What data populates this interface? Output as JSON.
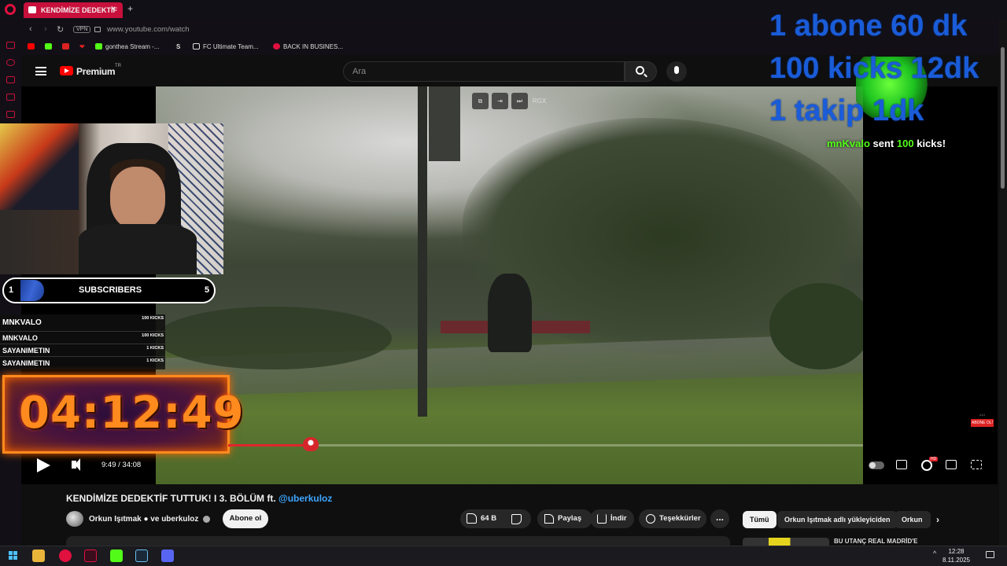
{
  "browser": {
    "tab_title": "KENDİMİZE DEDEKTİF",
    "tab_close": "×",
    "new_tab": "+",
    "vpn": "VPN",
    "url": "www.youtube.com/watch",
    "bookmarks": [
      {
        "label": "gonthea Stream -...",
        "color": "#53fc18"
      },
      {
        "label": "FC Ultimate Team...",
        "color": "#ffffff"
      },
      {
        "label": "BACK IN BUSINES...",
        "color": "#e0103f"
      }
    ],
    "bookmark_s": "S"
  },
  "youtube": {
    "brand": "Premium",
    "region": "TR",
    "search_placeholder": "Ara"
  },
  "video_overlays": {
    "pip_label": "RGX",
    "goals": [
      "1 abone 60 dk",
      "100 kicks 12dk",
      "1 takip 1dk"
    ],
    "kick_alert": {
      "user": "mnKvalo",
      "text_sent": "sent",
      "amount": "100",
      "text_kicks": "kicks!"
    },
    "subs_bar": {
      "start": "1",
      "label": "SUBSCRIBERS",
      "goal": "5",
      "progress_fraction": 0.2
    },
    "leaderboard": {
      "top": {
        "name": "MNKVALO",
        "value": "100 KICKS"
      },
      "rows": [
        {
          "name": "MNKVALO",
          "value": "100 KICKS"
        },
        {
          "name": "SAYANIMETIN",
          "value": "1 KICKS"
        },
        {
          "name": "SAYANIMETIN",
          "value": "1 KICKS"
        }
      ]
    },
    "countdown": "04:12:49",
    "abone_ol_label": "ABONE OL!",
    "abone_arrows": "↓↓↓"
  },
  "player": {
    "time_current": "9:49",
    "time_total": "34:08",
    "time_separator": " / ",
    "progress_fraction": 0.287,
    "hd_badge": "HD"
  },
  "video_info": {
    "title": "KENDİMİZE DEDEKTİF TUTTUK! I 3. BÖLÜM ft.",
    "title_link": "@uberkuloz",
    "channel": "Orkun Işıtmak ● ve uberkuloz",
    "subscribe": "Abone ol",
    "likes": "64 B",
    "share": "Paylaş",
    "download": "İndir",
    "thanks": "Teşekkürler",
    "more": "..."
  },
  "chips": [
    "Tümü",
    "Orkun Işıtmak adlı yükleyiciden",
    "Orkun"
  ],
  "rec_peek": "BU UTANÇ REAL MADRİD'E",
  "taskbar": {
    "time": "12:28",
    "date": "8.11.2025",
    "tray_caret": "^",
    "apps": [
      {
        "name": "explorer",
        "color": "#e8b43a"
      },
      {
        "name": "opera-gx",
        "color": "#e0103f"
      },
      {
        "name": "opera-gx-active",
        "color": "#3a0d1c"
      },
      {
        "name": "kick",
        "color": "#53fc18"
      },
      {
        "name": "steam",
        "color": "#1b2838"
      },
      {
        "name": "discord",
        "color": "#5865f2"
      }
    ]
  }
}
